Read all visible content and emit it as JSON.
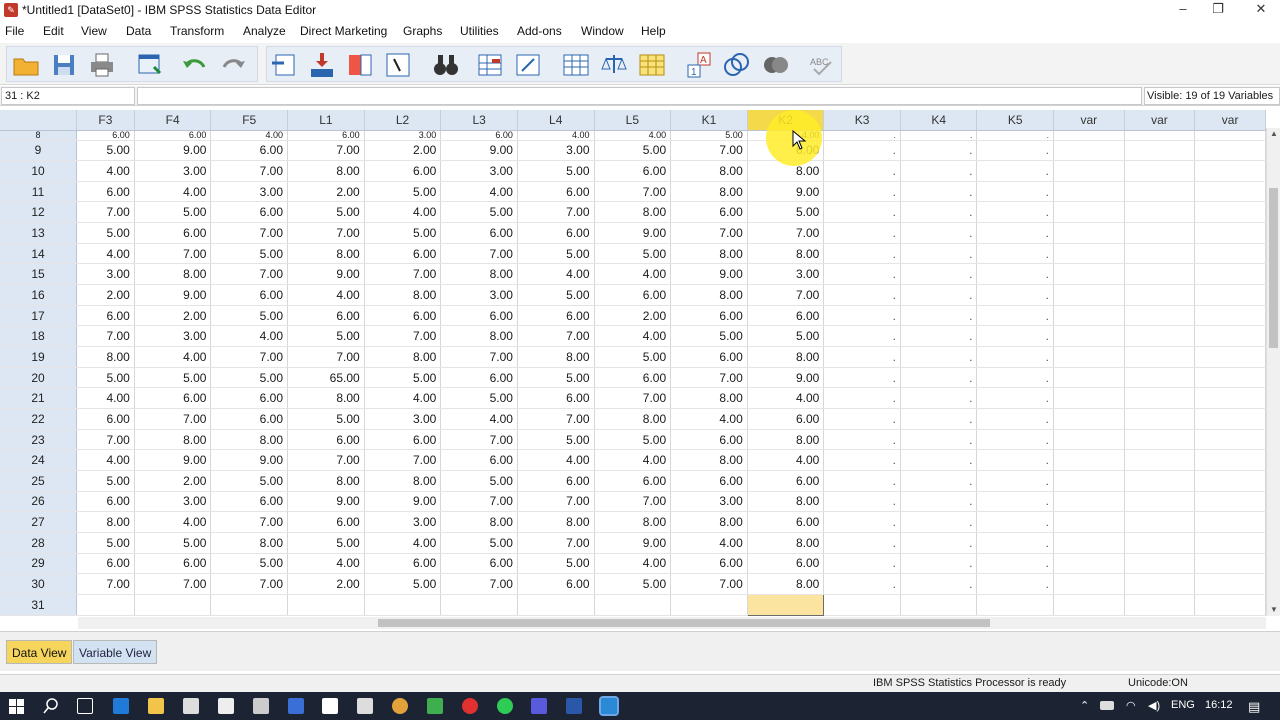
{
  "window": {
    "title": "*Untitled1 [DataSet0] - IBM SPSS Statistics Data Editor",
    "minimize": "–",
    "restore": "❐",
    "close": "✕"
  },
  "menu": [
    "File",
    "Edit",
    "View",
    "Data",
    "Transform",
    "Analyze",
    "Direct Marketing",
    "Graphs",
    "Utilities",
    "Add-ons",
    "Window",
    "Help"
  ],
  "cellbar": {
    "ref": "31 : K2",
    "value": "",
    "visible": "Visible: 19 of 19 Variables"
  },
  "columns": [
    "F3",
    "F4",
    "F5",
    "L1",
    "L2",
    "L3",
    "L4",
    "L5",
    "K1",
    "K2",
    "K3",
    "K4",
    "K5",
    "var",
    "var",
    "var"
  ],
  "partial_row": {
    "num": "8",
    "values": [
      "6.00",
      "6.00",
      "4.00",
      "6.00",
      "3.00",
      "6.00",
      "4.00",
      "4.00",
      "5.00",
      "4.00"
    ]
  },
  "rows": [
    {
      "num": "9",
      "values": [
        "5.00",
        "9.00",
        "6.00",
        "7.00",
        "2.00",
        "9.00",
        "3.00",
        "5.00",
        "7.00",
        "6.00"
      ]
    },
    {
      "num": "10",
      "values": [
        "4.00",
        "3.00",
        "7.00",
        "8.00",
        "6.00",
        "3.00",
        "5.00",
        "6.00",
        "8.00",
        "8.00"
      ]
    },
    {
      "num": "11",
      "values": [
        "6.00",
        "4.00",
        "3.00",
        "2.00",
        "5.00",
        "4.00",
        "6.00",
        "7.00",
        "8.00",
        "9.00"
      ]
    },
    {
      "num": "12",
      "values": [
        "7.00",
        "5.00",
        "6.00",
        "5.00",
        "4.00",
        "5.00",
        "7.00",
        "8.00",
        "6.00",
        "5.00"
      ]
    },
    {
      "num": "13",
      "values": [
        "5.00",
        "6.00",
        "7.00",
        "7.00",
        "5.00",
        "6.00",
        "6.00",
        "9.00",
        "7.00",
        "7.00"
      ]
    },
    {
      "num": "14",
      "values": [
        "4.00",
        "7.00",
        "5.00",
        "8.00",
        "6.00",
        "7.00",
        "5.00",
        "5.00",
        "8.00",
        "8.00"
      ]
    },
    {
      "num": "15",
      "values": [
        "3.00",
        "8.00",
        "7.00",
        "9.00",
        "7.00",
        "8.00",
        "4.00",
        "4.00",
        "9.00",
        "3.00"
      ]
    },
    {
      "num": "16",
      "values": [
        "2.00",
        "9.00",
        "6.00",
        "4.00",
        "8.00",
        "3.00",
        "5.00",
        "6.00",
        "8.00",
        "7.00"
      ]
    },
    {
      "num": "17",
      "values": [
        "6.00",
        "2.00",
        "5.00",
        "6.00",
        "6.00",
        "6.00",
        "6.00",
        "2.00",
        "6.00",
        "6.00"
      ]
    },
    {
      "num": "18",
      "values": [
        "7.00",
        "3.00",
        "4.00",
        "5.00",
        "7.00",
        "8.00",
        "7.00",
        "4.00",
        "5.00",
        "5.00"
      ]
    },
    {
      "num": "19",
      "values": [
        "8.00",
        "4.00",
        "7.00",
        "7.00",
        "8.00",
        "7.00",
        "8.00",
        "5.00",
        "6.00",
        "8.00"
      ]
    },
    {
      "num": "20",
      "values": [
        "5.00",
        "5.00",
        "5.00",
        "65.00",
        "5.00",
        "6.00",
        "5.00",
        "6.00",
        "7.00",
        "9.00"
      ]
    },
    {
      "num": "21",
      "values": [
        "4.00",
        "6.00",
        "6.00",
        "8.00",
        "4.00",
        "5.00",
        "6.00",
        "7.00",
        "8.00",
        "4.00"
      ]
    },
    {
      "num": "22",
      "values": [
        "6.00",
        "7.00",
        "6.00",
        "5.00",
        "3.00",
        "4.00",
        "7.00",
        "8.00",
        "4.00",
        "6.00"
      ]
    },
    {
      "num": "23",
      "values": [
        "7.00",
        "8.00",
        "8.00",
        "6.00",
        "6.00",
        "7.00",
        "5.00",
        "5.00",
        "6.00",
        "8.00"
      ]
    },
    {
      "num": "24",
      "values": [
        "4.00",
        "9.00",
        "9.00",
        "7.00",
        "7.00",
        "6.00",
        "4.00",
        "4.00",
        "8.00",
        "4.00"
      ]
    },
    {
      "num": "25",
      "values": [
        "5.00",
        "2.00",
        "5.00",
        "8.00",
        "8.00",
        "5.00",
        "6.00",
        "6.00",
        "6.00",
        "6.00"
      ]
    },
    {
      "num": "26",
      "values": [
        "6.00",
        "3.00",
        "6.00",
        "9.00",
        "9.00",
        "7.00",
        "7.00",
        "7.00",
        "3.00",
        "8.00"
      ]
    },
    {
      "num": "27",
      "values": [
        "8.00",
        "4.00",
        "7.00",
        "6.00",
        "3.00",
        "8.00",
        "8.00",
        "8.00",
        "8.00",
        "6.00"
      ]
    },
    {
      "num": "28",
      "values": [
        "5.00",
        "5.00",
        "8.00",
        "5.00",
        "4.00",
        "5.00",
        "7.00",
        "9.00",
        "4.00",
        "8.00"
      ]
    },
    {
      "num": "29",
      "values": [
        "6.00",
        "6.00",
        "5.00",
        "4.00",
        "6.00",
        "6.00",
        "5.00",
        "4.00",
        "6.00",
        "6.00"
      ]
    },
    {
      "num": "30",
      "values": [
        "7.00",
        "7.00",
        "7.00",
        "2.00",
        "5.00",
        "7.00",
        "6.00",
        "5.00",
        "7.00",
        "8.00"
      ]
    }
  ],
  "empty_row": {
    "num": "31"
  },
  "missing_marker": ".",
  "tabs": {
    "data_view": "Data View",
    "variable_view": "Variable View"
  },
  "status": {
    "processor": "IBM SPSS Statistics Processor is ready",
    "unicode": "Unicode:ON"
  },
  "taskbar": {
    "lang": "ENG",
    "time": "16:12"
  },
  "colors": {
    "header_bg": "#dde7f3",
    "selected_header": "#f4d94a",
    "data_tab": "#f6d55c",
    "active_cell": "#fbe3a0",
    "taskbar": "#1c2433"
  }
}
